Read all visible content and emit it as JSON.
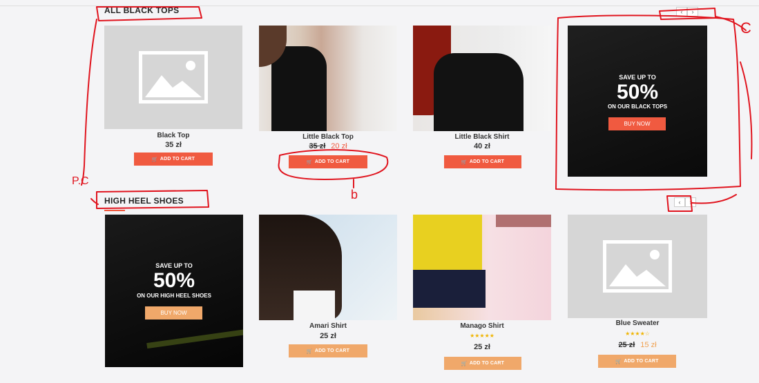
{
  "sections": [
    {
      "title": "ALL BLACK TOPS",
      "products": [
        {
          "name": "Black Top",
          "price": "35 zł",
          "cart_label": "ADD TO CART"
        },
        {
          "name": "Little Black Top",
          "old_price": "35 zł",
          "new_price": "20 zł",
          "cart_label": "ADD TO CART"
        },
        {
          "name": "Little Black Shirt",
          "price": "40 zł",
          "cart_label": "ADD TO CART"
        }
      ],
      "promo": {
        "save": "SAVE UP TO",
        "percent": "50%",
        "line": "ON OUR BLACK TOPS",
        "button": "BUY NOW"
      }
    },
    {
      "title": "HIGH HEEL SHOES",
      "promo": {
        "save": "SAVE UP TO",
        "percent": "50%",
        "line": "ON OUR HIGH HEEL SHOES",
        "button": "BUY NOW"
      },
      "products": [
        {
          "name": "Amari Shirt",
          "price": "25 zł",
          "cart_label": "ADD TO CART"
        },
        {
          "name": "Manago Shirt",
          "stars": "★★★★★",
          "rating": 5,
          "price": "25 zł",
          "cart_label": "ADD TO CART"
        },
        {
          "name": "Blue Sweater",
          "stars": "★★★★☆",
          "rating": 4,
          "old_price": "25 zł",
          "new_price": "15 zł",
          "cart_label": "ADD TO CART"
        }
      ]
    }
  ],
  "nav": {
    "prev": "‹",
    "next": "›"
  },
  "annotations": {
    "pc": "P.C",
    "b": "b",
    "c": "C"
  },
  "colors": {
    "accent_red": "#f05a40",
    "accent_orange": "#f0a86a",
    "annotation": "#e0141e"
  },
  "icons": {
    "cart": "cart-icon",
    "placeholder": "image-placeholder-icon"
  }
}
